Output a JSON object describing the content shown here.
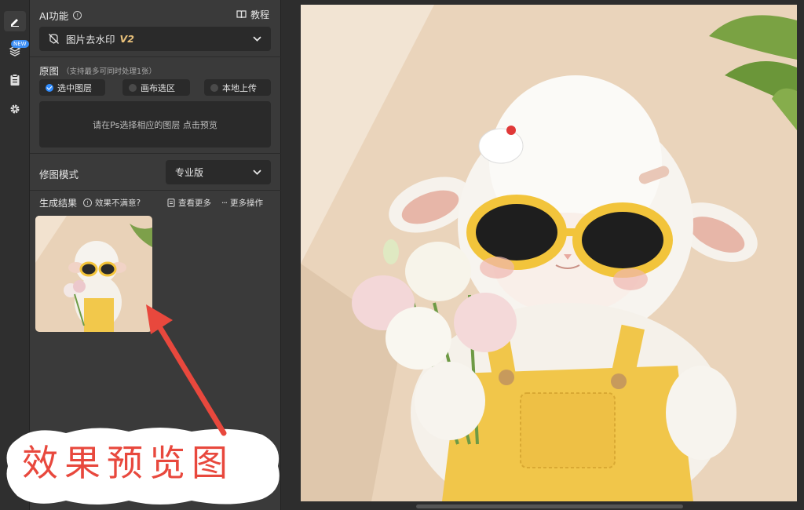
{
  "rail": {
    "icons": [
      "pencil-icon",
      "layers-icon",
      "clipboard-icon",
      "gear-icon"
    ],
    "new_badge": "NEW"
  },
  "ai": {
    "title": "AI功能",
    "tutorial_label": "教程",
    "feature_name": "图片去水印",
    "feature_version": "V2"
  },
  "source": {
    "title": "原图",
    "note": "（支持最多可同时处理1张）",
    "options": [
      "选中图层",
      "画布选区",
      "本地上传"
    ],
    "selected_option": "选中图层",
    "drop_hint": "请在Ps选择相应的图层 点击预览"
  },
  "mode": {
    "label": "修图模式",
    "value": "专业版"
  },
  "result": {
    "title": "生成结果",
    "unsatisfied": "效果不满意?",
    "view_more": "查看更多",
    "more_actions": "更多操作"
  },
  "annotation": {
    "text": "效果预览图",
    "color": "#e8483d"
  },
  "colors": {
    "accent": "#2f8cff",
    "version": "#e8c07a"
  }
}
